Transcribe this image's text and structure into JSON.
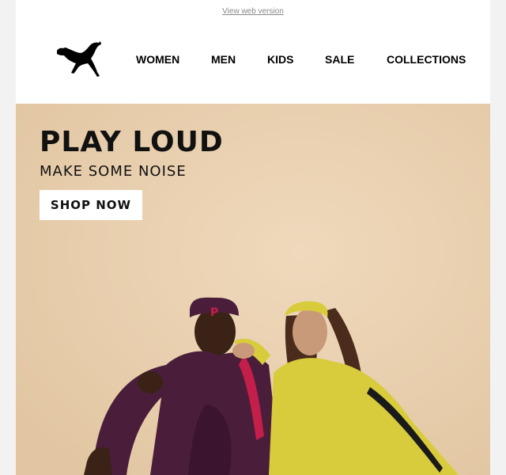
{
  "topbar": {
    "view_web_label": "View web version"
  },
  "header": {
    "logo_icon": "puma-cat-icon",
    "nav": [
      {
        "label": "WOMEN"
      },
      {
        "label": "MEN"
      },
      {
        "label": "KIDS"
      },
      {
        "label": "SALE"
      },
      {
        "label": "COLLECTIONS"
      }
    ]
  },
  "hero": {
    "headline": "PLAY LOUD",
    "subline": "MAKE SOME NOISE",
    "cta_label": "SHOP NOW",
    "background_color": "#e8cfae"
  },
  "colors": {
    "page": "#ffffff",
    "text": "#111111",
    "hero_bg": "#e8cfae",
    "outfit_maroon": "#4a1e3a",
    "outfit_stripe": "#c41e4a",
    "outfit_yellow": "#d8cc3c"
  }
}
